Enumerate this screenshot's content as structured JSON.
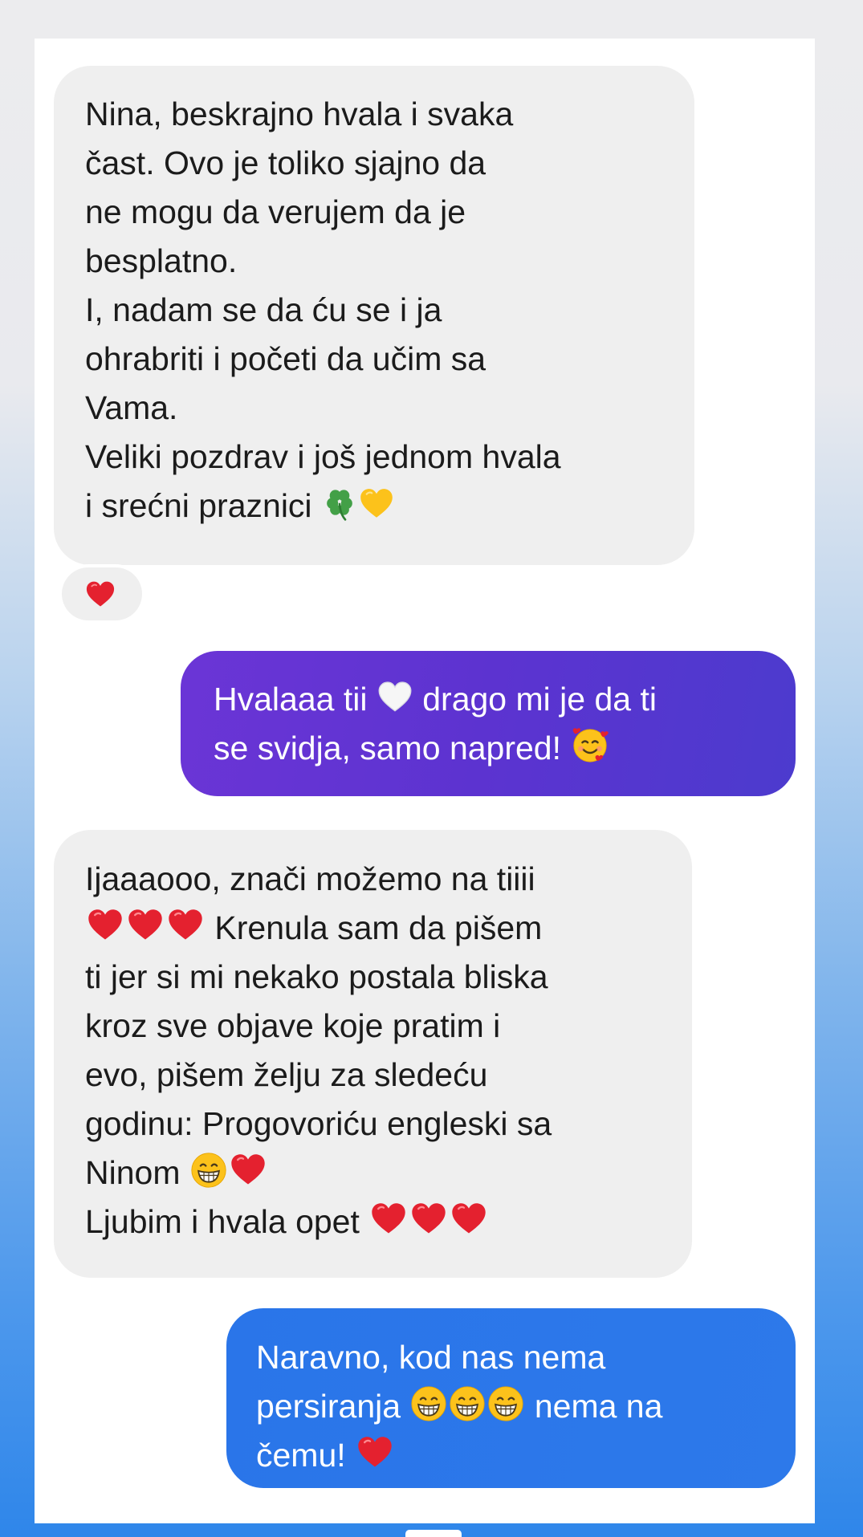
{
  "conversation": {
    "messages": [
      {
        "sender": "them",
        "lines": [
          "Nina, beskrajno hvala i svaka",
          "čast. Ovo je toliko sjajno da",
          "ne mogu da verujem da je",
          "besplatno.",
          "I, nadam se da ću se i ja",
          "ohrabriti i početi da učim sa",
          "Vama.",
          "Veliki pozdrav i još jednom hvala",
          "i srećni praznici"
        ],
        "trailing_emojis": [
          "four-leaf-clover",
          "yellow-heart"
        ],
        "reaction": "red-heart"
      },
      {
        "sender": "me",
        "lines": [
          "Hvalaaa tii",
          "drago mi je da ti",
          "se svidja, samo napred!"
        ],
        "emojis": [
          "white-heart",
          "smiling-face-with-hearts"
        ]
      },
      {
        "sender": "them",
        "lines": [
          "Ijaaaooo, znači možemo na tiiii",
          "Krenula sam da pišem",
          "ti jer si mi nekako postala bliska",
          "kroz sve objave koje pratim i",
          "evo, pišem želju za sledeću",
          "godinu: Progovoriću engleski sa",
          "Ninom",
          "Ljubim i hvala opet"
        ],
        "emojis": [
          "red-heart",
          "beaming-face"
        ]
      },
      {
        "sender": "me",
        "lines": [
          "Naravno, kod nas nema",
          "persiranja",
          "nema na",
          "čemu!"
        ],
        "emojis": [
          "beaming-face",
          "red-heart"
        ]
      }
    ]
  },
  "colors": {
    "incoming_bubble": "#efefef",
    "outgoing_purple": "#5c33d0",
    "outgoing_blue": "#2d79ea",
    "heart_red": "#e0202e"
  }
}
